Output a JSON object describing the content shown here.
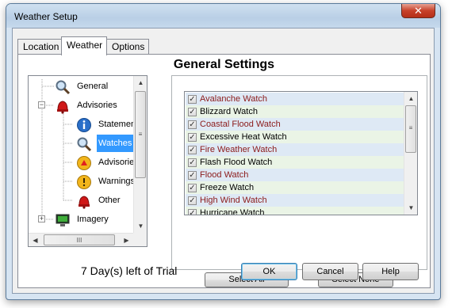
{
  "window": {
    "title": "Weather Setup",
    "close_symbol": "✕"
  },
  "tabs": [
    {
      "label": "Location"
    },
    {
      "label": "Weather"
    },
    {
      "label": "Options"
    }
  ],
  "heading": "General Settings",
  "tree": {
    "items": [
      {
        "label": "General",
        "icon": "magnifier-icon"
      },
      {
        "label": "Advisories",
        "icon": "alarm-bell-icon",
        "expand": "−"
      },
      {
        "label": "Statements",
        "icon": "info-icon"
      },
      {
        "label": "Watches",
        "icon": "magnifier-icon"
      },
      {
        "label": "Advisories",
        "icon": "advisory-icon"
      },
      {
        "label": "Warnings",
        "icon": "warning-icon"
      },
      {
        "label": "Other",
        "icon": "alarm-bell-icon"
      },
      {
        "label": "Imagery",
        "icon": "monitor-icon",
        "expand": "+"
      }
    ],
    "selected": "Watches"
  },
  "watch_list": {
    "items": [
      {
        "label": "Avalanche Watch",
        "color": "#8b1a1a",
        "checked": true
      },
      {
        "label": "Blizzard Watch",
        "color": "#000000",
        "checked": true
      },
      {
        "label": "Coastal Flood Watch",
        "color": "#8b1a1a",
        "checked": true
      },
      {
        "label": "Excessive Heat Watch",
        "color": "#000000",
        "checked": true
      },
      {
        "label": "Fire Weather Watch",
        "color": "#8b1a1a",
        "checked": true
      },
      {
        "label": "Flash Flood Watch",
        "color": "#000000",
        "checked": true
      },
      {
        "label": "Flood Watch",
        "color": "#8b1a1a",
        "checked": true
      },
      {
        "label": "Freeze Watch",
        "color": "#000000",
        "checked": true
      },
      {
        "label": "High Wind Watch",
        "color": "#8b1a1a",
        "checked": true
      },
      {
        "label": "Hurricane Watch",
        "color": "#000000",
        "checked": true
      }
    ],
    "check_mark": "✓"
  },
  "buttons": {
    "select_all": "Select All",
    "select_none": "Select None",
    "ok": "OK",
    "cancel": "Cancel",
    "help": "Help"
  },
  "trial_text": "7 Day(s) left of Trial",
  "scroll_glyphs": {
    "up": "▲",
    "down": "▼",
    "left": "◀",
    "right": "▶",
    "grip_v": "≡",
    "grip_h": "III"
  },
  "colors": {
    "accent": "#3399ff",
    "window_frame": "#d6e4f2",
    "close": "#c7412a"
  }
}
